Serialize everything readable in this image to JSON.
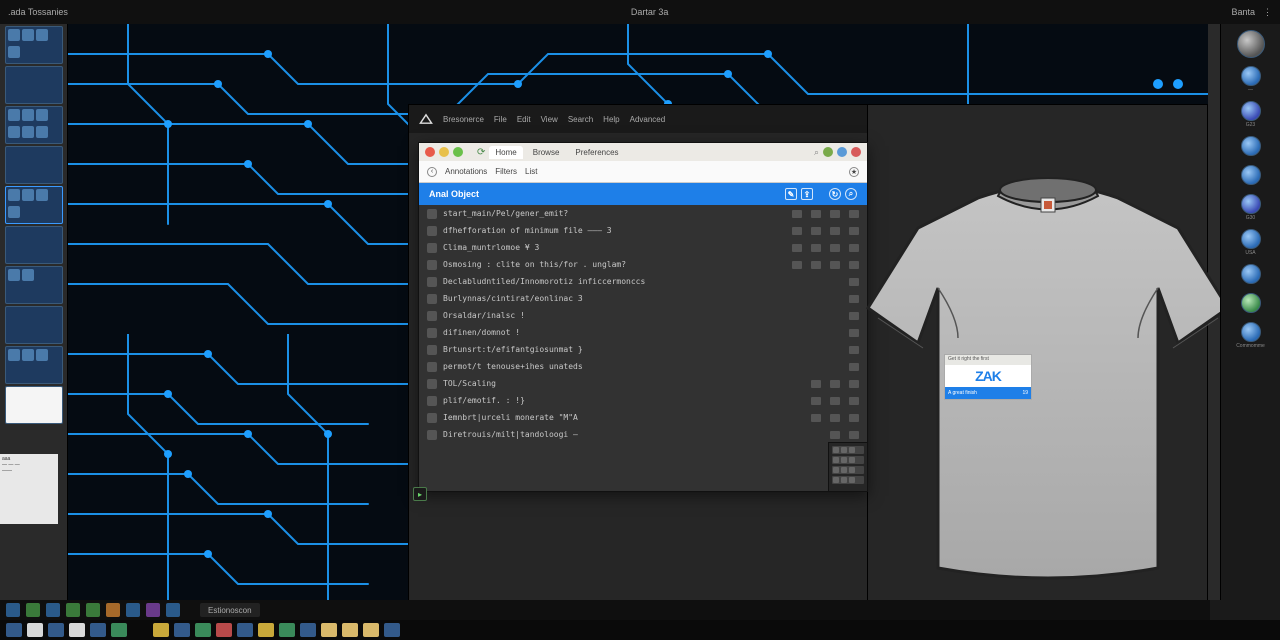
{
  "titlebar": {
    "left": ".ada Tossanies",
    "center": "Dartar 3a",
    "right": "Banta"
  },
  "brandbar": {
    "name": "Bresonerce",
    "items": [
      "File",
      "Edit",
      "View",
      "Search",
      "Help",
      "Advanced"
    ]
  },
  "chrome": {
    "tab1": "Home",
    "tab2": "Browse",
    "tab3": "Preferences"
  },
  "toolbar": {
    "p1": "Annotations",
    "p2": "Filters",
    "p3": "List"
  },
  "headerbar": {
    "title": "Anal Object"
  },
  "files": [
    "start_main/Pel/gener_emit?",
    "dfhefforation of minimum file  ——— 3",
    "Clima_muntrlomoе ¥ 3",
    "Osmosing : clitе  on  this/for . unglam?",
    "Declabludntiled/Innomorotiz  inficcermonccs",
    "Burlynnas/cintirat/eonlinac 3",
    "Orsaldar/inalsc !",
    "difinen/domnot !",
    "Brtunsrt:t/efifantgiosunmat }",
    "permot/t tenouse+ihes unateds",
    "TOL/Scaling",
    "plif/emotif.  : !}",
    "Iemnbrt|urceli  monerate  \"M\"A",
    "Diretrouis/milt|tandoloogi —"
  ],
  "product_tag": {
    "header": "Get it right the first",
    "brand": "ZAK",
    "footer": "A great finish",
    "corner": "19"
  },
  "rsidebar_labels": [
    "",
    "—",
    "G23",
    "",
    "",
    "G30",
    "USA",
    "",
    "",
    "Commomme"
  ],
  "taskbar": {
    "label": "Estionoscon"
  }
}
